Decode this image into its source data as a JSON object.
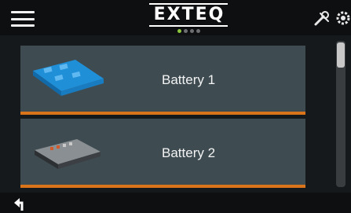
{
  "header": {
    "logo_text": "EXTEQ",
    "page_indicator": {
      "count": 4,
      "active_index": 0
    },
    "icons": [
      "menu-icon",
      "tools-icon",
      "settings-icon"
    ]
  },
  "list": {
    "items": [
      {
        "label": "Battery 1",
        "image": "battery-module-blue-icon"
      },
      {
        "label": "Battery 2",
        "image": "battery-module-dark-icon"
      }
    ]
  },
  "footer": {
    "icons": [
      "back-icon"
    ]
  },
  "colors": {
    "card_bg": "#3e4c52",
    "accent_underline": "#d9741a",
    "active_dot": "#8cc63f"
  }
}
